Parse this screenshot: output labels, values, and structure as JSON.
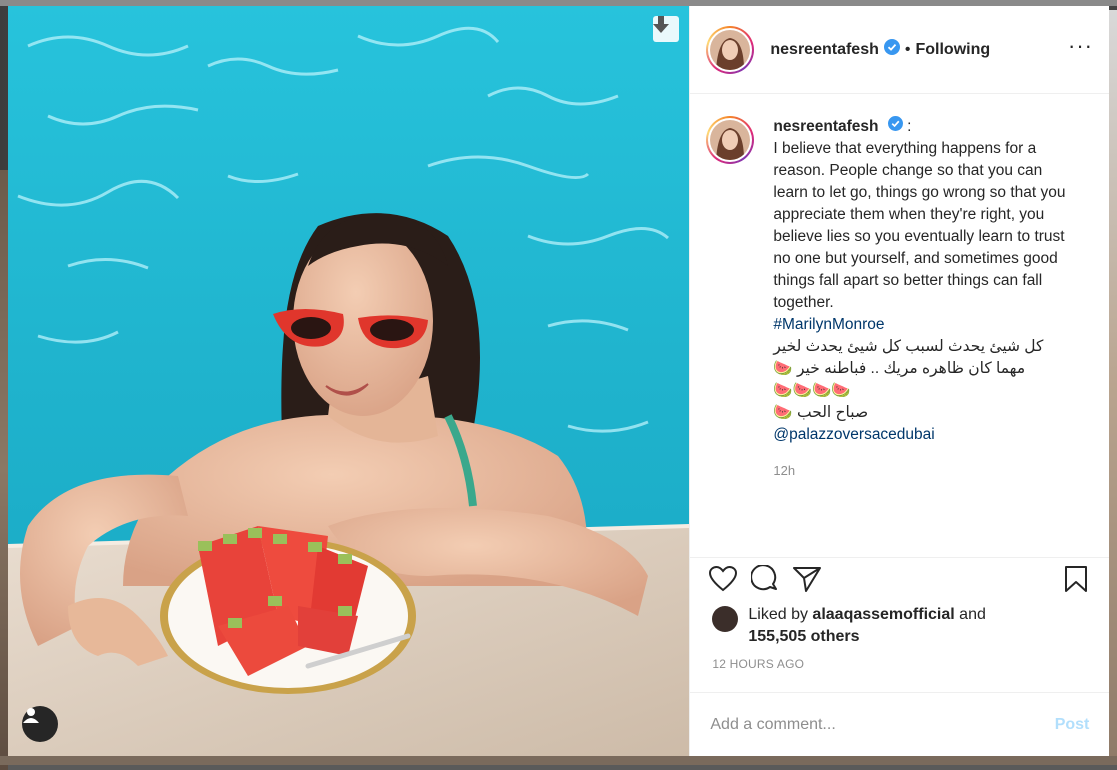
{
  "post": {
    "username": "nesreentafesh",
    "follow_status": "Following",
    "separator": "•",
    "more_icon": "more-options-icon",
    "verified_icon": "verified-badge-icon"
  },
  "caption": {
    "username": "nesreentafesh",
    "colon": ":",
    "text": "I believe that everything happens for a reason. People change so that you can learn to let go, things go wrong so that you appreciate them when they're right, you believe lies so you eventually learn to trust no one but yourself, and sometimes good things fall apart so better things can fall together.",
    "hashtag": "#MarilynMonroe",
    "arabic_line1": "كل شيئ يحدث لسبب كل شيئ يحدث لخير",
    "arabic_line2": "مهما كان ظاهره مريك .. فباطنه خير 🍉",
    "emoji_line": "🍉🍉🍉🍉",
    "arabic_line3": "صباح الحب 🍉",
    "mention": "@palazzoversacedubai",
    "time": "12h"
  },
  "actions": {
    "like_icon": "heart-icon",
    "comment_icon": "comment-icon",
    "share_icon": "share-icon",
    "save_icon": "bookmark-icon"
  },
  "likes": {
    "prefix": "Liked by",
    "user": "alaaqassemofficial",
    "joiner": "and",
    "others": "155,505 others"
  },
  "timestamp": "12 HOURS AGO",
  "comment_box": {
    "placeholder": "Add a comment...",
    "post_label": "Post"
  },
  "colors": {
    "link": "#00376b",
    "post_disabled": "#b2dffc",
    "muted": "#8e8e8e",
    "text": "#262626"
  }
}
